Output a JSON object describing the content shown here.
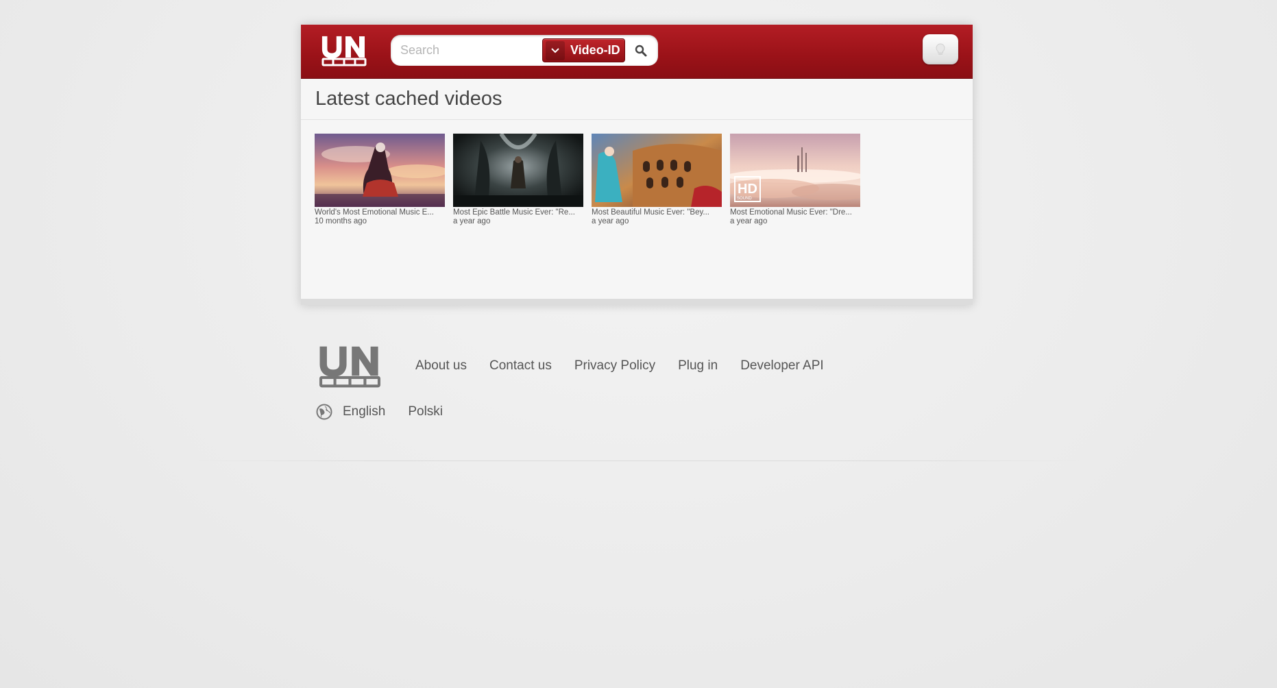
{
  "header": {
    "logo_alt": "UN",
    "search_placeholder": "Search",
    "search_value": "",
    "search_type": "Video-ID",
    "icons": {
      "logo": "site-logo",
      "dropdown": "chevron-down-icon",
      "search": "search-icon",
      "light": "lightbulb-icon"
    }
  },
  "main": {
    "title": "Latest cached videos",
    "videos": [
      {
        "title": "World's Most Emotional Music E...",
        "age": "10 months ago"
      },
      {
        "title": "Most Epic Battle Music Ever: \"Re...",
        "age": "a year ago"
      },
      {
        "title": "Most Beautiful Music Ever: \"Bey...",
        "age": "a year ago"
      },
      {
        "title": "Most Emotional Music Ever: \"Dre...",
        "age": "a year ago"
      }
    ]
  },
  "footer": {
    "links": [
      "About us",
      "Contact us",
      "Privacy Policy",
      "Plug in",
      "Developer API"
    ],
    "languages": [
      "English",
      "Polski"
    ]
  },
  "colors": {
    "brand_red": "#9a1218",
    "background": "#ededed"
  }
}
